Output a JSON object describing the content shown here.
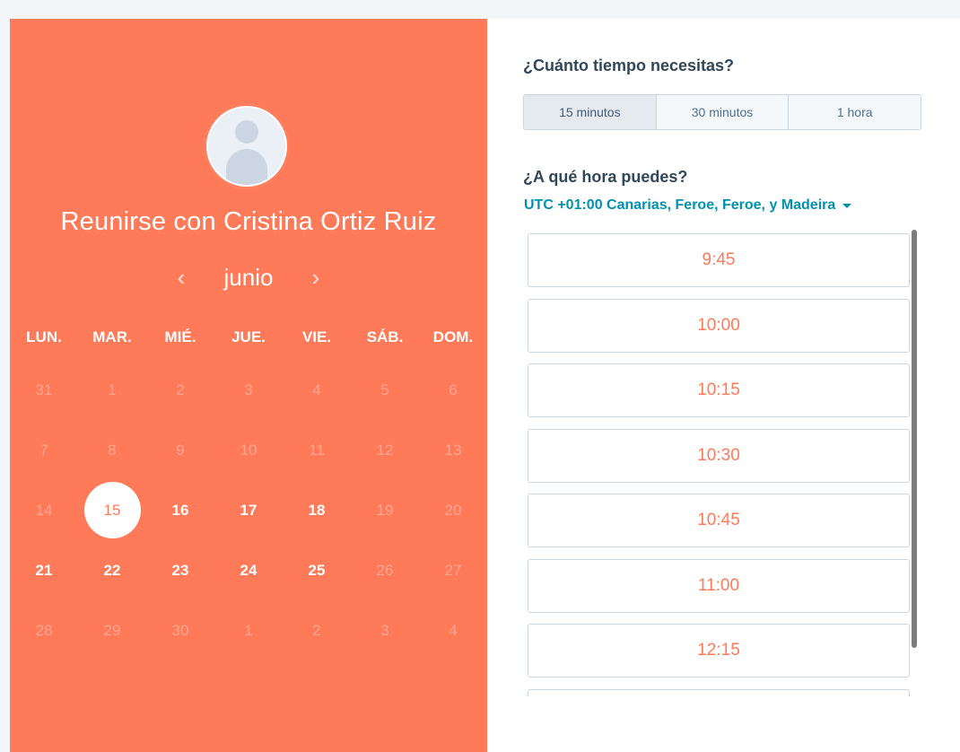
{
  "host": {
    "title": "Reunirse con Cristina Ortiz Ruiz"
  },
  "calendar": {
    "month": "junio",
    "prev_icon": "‹",
    "next_icon": "›",
    "weekdays": [
      "LUN.",
      "MAR.",
      "MIÉ.",
      "JUE.",
      "VIE.",
      "SÁB.",
      "DOM."
    ],
    "weeks": [
      [
        {
          "d": "31",
          "s": "dim"
        },
        {
          "d": "1",
          "s": "dim"
        },
        {
          "d": "2",
          "s": "dim"
        },
        {
          "d": "3",
          "s": "dim"
        },
        {
          "d": "4",
          "s": "dim"
        },
        {
          "d": "5",
          "s": "dim"
        },
        {
          "d": "6",
          "s": "dim"
        }
      ],
      [
        {
          "d": "7",
          "s": "dim"
        },
        {
          "d": "8",
          "s": "dim"
        },
        {
          "d": "9",
          "s": "dim"
        },
        {
          "d": "10",
          "s": "dim"
        },
        {
          "d": "11",
          "s": "dim"
        },
        {
          "d": "12",
          "s": "dim"
        },
        {
          "d": "13",
          "s": "dim"
        }
      ],
      [
        {
          "d": "14",
          "s": "dim"
        },
        {
          "d": "15",
          "s": "selected"
        },
        {
          "d": "16",
          "s": "avail"
        },
        {
          "d": "17",
          "s": "avail"
        },
        {
          "d": "18",
          "s": "avail"
        },
        {
          "d": "19",
          "s": "dim"
        },
        {
          "d": "20",
          "s": "dim"
        }
      ],
      [
        {
          "d": "21",
          "s": "avail"
        },
        {
          "d": "22",
          "s": "avail"
        },
        {
          "d": "23",
          "s": "avail"
        },
        {
          "d": "24",
          "s": "avail"
        },
        {
          "d": "25",
          "s": "avail"
        },
        {
          "d": "26",
          "s": "dim"
        },
        {
          "d": "27",
          "s": "dim"
        }
      ],
      [
        {
          "d": "28",
          "s": "dim"
        },
        {
          "d": "29",
          "s": "dim"
        },
        {
          "d": "30",
          "s": "dim"
        },
        {
          "d": "1",
          "s": "dim"
        },
        {
          "d": "2",
          "s": "dim"
        },
        {
          "d": "3",
          "s": "dim"
        },
        {
          "d": "4",
          "s": "dim"
        }
      ]
    ]
  },
  "duration": {
    "question": "¿Cuánto tiempo necesitas?",
    "options": [
      "15 minutos",
      "30 minutos",
      "1 hora"
    ],
    "selected": "15 minutos"
  },
  "time": {
    "question": "¿A qué hora puedes?",
    "timezone": "UTC +01:00 Canarias, Feroe, Feroe, y Madeira",
    "slots": [
      "9:45",
      "10:00",
      "10:15",
      "10:30",
      "10:45",
      "11:00",
      "12:15",
      ""
    ]
  },
  "colors": {
    "brand": "#ff7a59",
    "link": "#0091ae",
    "text": "#33475b"
  }
}
